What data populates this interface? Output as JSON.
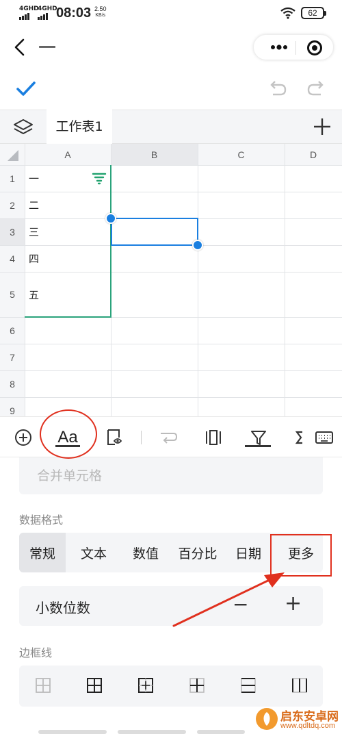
{
  "status_bar": {
    "sig1": "4GHD",
    "sig2": "4GHD",
    "time": "08:03",
    "speed_value": "2.50",
    "speed_unit": "KB/s",
    "battery": "62"
  },
  "nav": {
    "title": "一"
  },
  "sheet": {
    "tab_label": "工作表1",
    "columns": [
      "A",
      "B",
      "C",
      "D"
    ],
    "rows": [
      "1",
      "2",
      "3",
      "4",
      "5",
      "6",
      "7",
      "8",
      "9"
    ],
    "cells_a": [
      "一",
      "二",
      "三",
      "四",
      "五"
    ]
  },
  "panel": {
    "merge_cells": "合并单元格",
    "data_format_label": "数据格式",
    "formats": [
      "常规",
      "文本",
      "数值",
      "百分比",
      "日期",
      "更多"
    ],
    "decimal_label": "小数位数",
    "decimal_minus": "−",
    "decimal_plus": "+",
    "border_label": "边框线"
  },
  "toolbar": {
    "text_format_label": "Aa"
  },
  "watermark": {
    "name": "启东安卓网",
    "url": "www.qdltdq.com"
  },
  "colors": {
    "accent": "#1a7fe0",
    "selection_border": "#2aa37b",
    "annotation_red": "#e0301e",
    "filter_green": "#23a370"
  }
}
